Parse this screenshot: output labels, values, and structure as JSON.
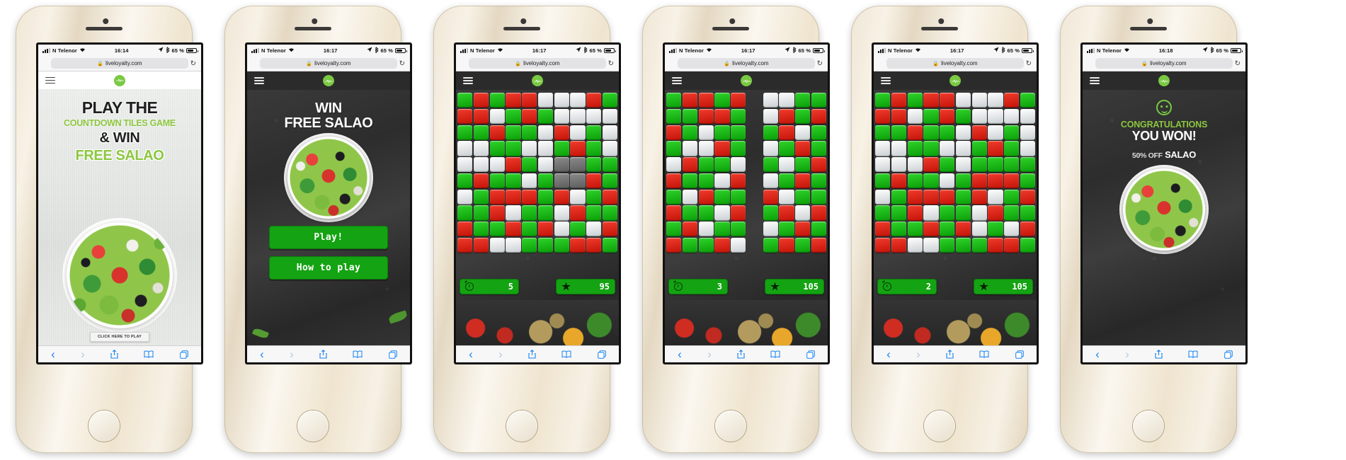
{
  "brand": {
    "name": "liveloyalty.com",
    "logo_icon": "pulse-logo-icon",
    "accent": "#8cc63e",
    "button_green": "#14a312"
  },
  "phones": [
    {
      "id": "phone-1",
      "status": {
        "carrier": "N Telenor",
        "time": "16:14",
        "battery": "65 %",
        "wifi_icon": "wifi-icon",
        "location_icon": "location-arrow-icon",
        "bluetooth_icon": "bluetooth-icon",
        "signal_icon": "signal-bars-icon"
      },
      "browser": {
        "url": "liveloyalty.com",
        "lock_icon": "lock-icon",
        "reload_icon": "reload-icon"
      },
      "screen": "promo-light",
      "headlines": {
        "line1": "PLAY THE",
        "line2": "COUNTDOWN TILES GAME",
        "line3": "& WIN",
        "line4": "FREE SALAO"
      },
      "cta": "CLICK HERE TO PLAY",
      "image_alt": "greek-salad-bowl"
    },
    {
      "id": "phone-2",
      "status": {
        "carrier": "N Telenor",
        "time": "16:17",
        "battery": "65 %",
        "wifi_icon": "wifi-icon",
        "location_icon": "location-arrow-icon",
        "bluetooth_icon": "bluetooth-icon",
        "signal_icon": "signal-bars-icon"
      },
      "browser": {
        "url": "liveloyalty.com",
        "lock_icon": "lock-icon",
        "reload_icon": "reload-icon"
      },
      "screen": "promo-dark",
      "headlines": {
        "line1": "WIN",
        "line2": "FREE SALAO"
      },
      "buttons": {
        "play": "Play!",
        "howto": "How to play"
      },
      "image_alt": "greek-salad-bowl"
    },
    {
      "id": "phone-3",
      "status": {
        "carrier": "N Telenor",
        "time": "16:17",
        "battery": "65 %",
        "wifi_icon": "wifi-icon",
        "location_icon": "location-arrow-icon",
        "bluetooth_icon": "bluetooth-icon",
        "signal_icon": "signal-bars-icon"
      },
      "browser": {
        "url": "liveloyalty.com",
        "lock_icon": "lock-icon",
        "reload_icon": "reload-icon"
      },
      "screen": "game",
      "hud": {
        "timer_icon": "stopwatch-icon",
        "timer_value": "5",
        "score_icon": "star-icon",
        "score_value": "95"
      },
      "grid": [
        [
          "g",
          "r",
          "g",
          "r",
          "r",
          "w",
          "w",
          "w",
          "r",
          "g"
        ],
        [
          "r",
          "r",
          "w",
          "g",
          "r",
          "g",
          "w",
          "w",
          "w",
          "w"
        ],
        [
          "g",
          "g",
          "r",
          "g",
          "g",
          "w",
          "r",
          "w",
          "g",
          "w"
        ],
        [
          "w",
          "w",
          "g",
          "g",
          "w",
          "w",
          "g",
          "r",
          "g",
          "w"
        ],
        [
          "w",
          "w",
          "w",
          "r",
          "g",
          "w",
          "d",
          "d",
          "g",
          "g"
        ],
        [
          "g",
          "r",
          "g",
          "g",
          "w",
          "g",
          "d",
          "d",
          "r",
          "g"
        ],
        [
          "w",
          "g",
          "r",
          "r",
          "r",
          "g",
          "r",
          "w",
          "g",
          "r"
        ],
        [
          "g",
          "g",
          "r",
          "w",
          "g",
          "g",
          "w",
          "r",
          "g",
          "g"
        ],
        [
          "r",
          "g",
          "g",
          "r",
          "g",
          "r",
          "w",
          "g",
          "w",
          "r"
        ],
        [
          "r",
          "r",
          "w",
          "w",
          "g",
          "g",
          "g",
          "r",
          "r",
          "g"
        ]
      ]
    },
    {
      "id": "phone-4",
      "status": {
        "carrier": "N Telenor",
        "time": "16:17",
        "battery": "65 %",
        "wifi_icon": "wifi-icon",
        "location_icon": "location-arrow-icon",
        "bluetooth_icon": "bluetooth-icon",
        "signal_icon": "signal-bars-icon"
      },
      "browser": {
        "url": "liveloyalty.com",
        "lock_icon": "lock-icon",
        "reload_icon": "reload-icon"
      },
      "screen": "game",
      "hud": {
        "timer_icon": "stopwatch-icon",
        "timer_value": "3",
        "score_icon": "star-icon",
        "score_value": "105"
      },
      "grid": [
        [
          "g",
          "r",
          "r",
          "g",
          "r",
          "e",
          "w",
          "w",
          "g",
          "g"
        ],
        [
          "g",
          "g",
          "r",
          "r",
          "g",
          "e",
          "w",
          "r",
          "g",
          "r"
        ],
        [
          "r",
          "g",
          "w",
          "g",
          "g",
          "e",
          "g",
          "r",
          "w",
          "g"
        ],
        [
          "g",
          "w",
          "w",
          "r",
          "g",
          "e",
          "w",
          "g",
          "r",
          "g"
        ],
        [
          "w",
          "r",
          "g",
          "g",
          "w",
          "e",
          "g",
          "w",
          "g",
          "r"
        ],
        [
          "r",
          "g",
          "g",
          "w",
          "r",
          "e",
          "w",
          "g",
          "r",
          "g"
        ],
        [
          "g",
          "w",
          "r",
          "g",
          "g",
          "e",
          "r",
          "w",
          "g",
          "g"
        ],
        [
          "r",
          "g",
          "g",
          "w",
          "r",
          "e",
          "g",
          "r",
          "w",
          "r"
        ],
        [
          "g",
          "r",
          "w",
          "g",
          "g",
          "e",
          "w",
          "g",
          "r",
          "g"
        ],
        [
          "r",
          "g",
          "g",
          "r",
          "w",
          "e",
          "g",
          "r",
          "g",
          "r"
        ]
      ]
    },
    {
      "id": "phone-5",
      "status": {
        "carrier": "N Telenor",
        "time": "16:17",
        "battery": "65 %",
        "wifi_icon": "wifi-icon",
        "location_icon": "location-arrow-icon",
        "bluetooth_icon": "bluetooth-icon",
        "signal_icon": "signal-bars-icon"
      },
      "browser": {
        "url": "liveloyalty.com",
        "lock_icon": "lock-icon",
        "reload_icon": "reload-icon"
      },
      "screen": "game",
      "hud": {
        "timer_icon": "stopwatch-icon",
        "timer_value": "2",
        "score_icon": "star-icon",
        "score_value": "105"
      },
      "grid": [
        [
          "g",
          "r",
          "g",
          "r",
          "r",
          "w",
          "w",
          "w",
          "r",
          "g"
        ],
        [
          "r",
          "r",
          "w",
          "g",
          "r",
          "g",
          "w",
          "w",
          "w",
          "w"
        ],
        [
          "g",
          "g",
          "r",
          "g",
          "g",
          "w",
          "r",
          "w",
          "g",
          "w"
        ],
        [
          "w",
          "w",
          "g",
          "g",
          "w",
          "w",
          "g",
          "r",
          "g",
          "w"
        ],
        [
          "w",
          "w",
          "w",
          "r",
          "g",
          "w",
          "g",
          "g",
          "g",
          "g"
        ],
        [
          "g",
          "r",
          "g",
          "g",
          "w",
          "g",
          "r",
          "r",
          "r",
          "g"
        ],
        [
          "w",
          "g",
          "r",
          "r",
          "r",
          "g",
          "r",
          "w",
          "g",
          "r"
        ],
        [
          "g",
          "g",
          "r",
          "w",
          "g",
          "g",
          "w",
          "r",
          "g",
          "g"
        ],
        [
          "r",
          "g",
          "g",
          "r",
          "g",
          "r",
          "w",
          "g",
          "w",
          "r"
        ],
        [
          "r",
          "r",
          "w",
          "w",
          "g",
          "g",
          "g",
          "r",
          "r",
          "g"
        ]
      ]
    },
    {
      "id": "phone-6",
      "status": {
        "carrier": "N Telenor",
        "time": "16:18",
        "battery": "65 %",
        "wifi_icon": "wifi-icon",
        "location_icon": "location-arrow-icon",
        "bluetooth_icon": "bluetooth-icon",
        "signal_icon": "signal-bars-icon"
      },
      "browser": {
        "url": "liveloyalty.com",
        "lock_icon": "lock-icon",
        "reload_icon": "reload-icon"
      },
      "screen": "congrats",
      "headlines": {
        "line1": "CONGRATULATIONS",
        "line2": "YOU WON!",
        "prize_amount": "50% OFF",
        "prize_item": "SALAO"
      },
      "smiley_icon": "smiley-face-icon",
      "image_alt": "greek-salad-bowl"
    }
  ],
  "toolbar": {
    "back_icon": "chevron-left-icon",
    "forward_icon": "chevron-right-icon",
    "share_icon": "share-icon",
    "bookmarks_icon": "book-icon",
    "tabs_icon": "tabs-icon"
  }
}
